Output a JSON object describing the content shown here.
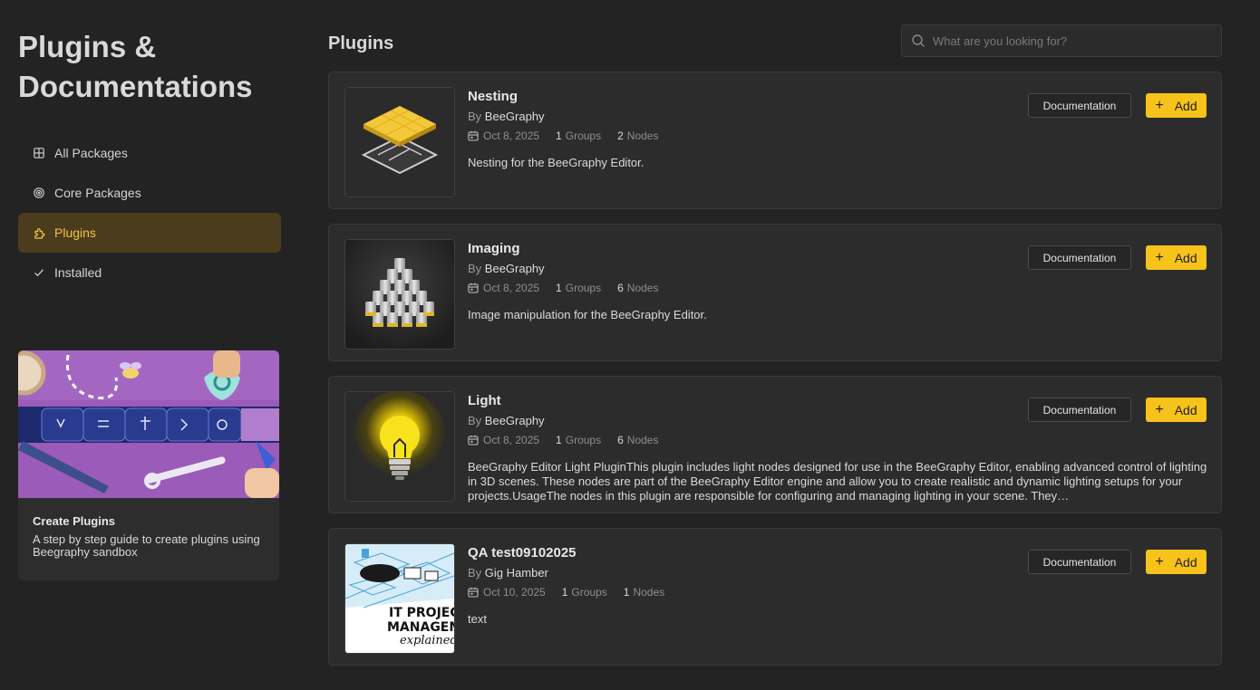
{
  "sidebar": {
    "title": "Plugins &\nDocumentations",
    "nav": [
      {
        "label": "All Packages",
        "icon": "grid-icon",
        "active": false
      },
      {
        "label": "Core Packages",
        "icon": "target-icon",
        "active": false
      },
      {
        "label": "Plugins",
        "icon": "puzzle-icon",
        "active": true
      },
      {
        "label": "Installed",
        "icon": "check-icon",
        "active": false
      }
    ],
    "promo": {
      "title": "Create Plugins",
      "description": "A step by step guide to create plugins using Beegraphy sandbox"
    }
  },
  "main": {
    "title": "Plugins",
    "search_placeholder": "What are you looking for?",
    "doc_label": "Documentation",
    "add_label": "Add",
    "by_label": "By",
    "groups_label": "Groups",
    "nodes_label": "Nodes",
    "plugins": [
      {
        "name": "Nesting",
        "author": "BeeGraphy",
        "date": "Oct 8, 2025",
        "groups": "1",
        "nodes": "2",
        "description": "Nesting for the BeeGraphy Editor.",
        "thumb": "nesting"
      },
      {
        "name": "Imaging",
        "author": "BeeGraphy",
        "date": "Oct 8, 2025",
        "groups": "1",
        "nodes": "6",
        "description": "Image manipulation for the BeeGraphy Editor.",
        "thumb": "imaging"
      },
      {
        "name": "Light",
        "author": "BeeGraphy",
        "date": "Oct 8, 2025",
        "groups": "1",
        "nodes": "6",
        "description": "BeeGraphy Editor Light PluginThis plugin includes light nodes designed for use in the BeeGraphy Editor, enabling advanced control of lighting in 3D scenes. These nodes are part of the BeeGraphy Editor engine and allow you to create realistic and dynamic lighting setups for your projects.UsageThe nodes in this plugin are responsible for configuring and managing lighting in your scene. They…",
        "thumb": "light"
      },
      {
        "name": "QA test09102025",
        "author": "Gig Hamber",
        "date": "Oct 10, 2025",
        "groups": "1",
        "nodes": "1",
        "description": "text",
        "thumb": "it-project",
        "thumb_text_1": "IT PROJECT",
        "thumb_text_2": "MANAGEMENT",
        "thumb_text_3": "explained"
      }
    ]
  },
  "colors": {
    "accent": "#f7c21a",
    "active_nav_bg": "#4b3c1d",
    "active_nav_text": "#f2c543",
    "background": "#232323",
    "card": "#2c2c2c"
  }
}
